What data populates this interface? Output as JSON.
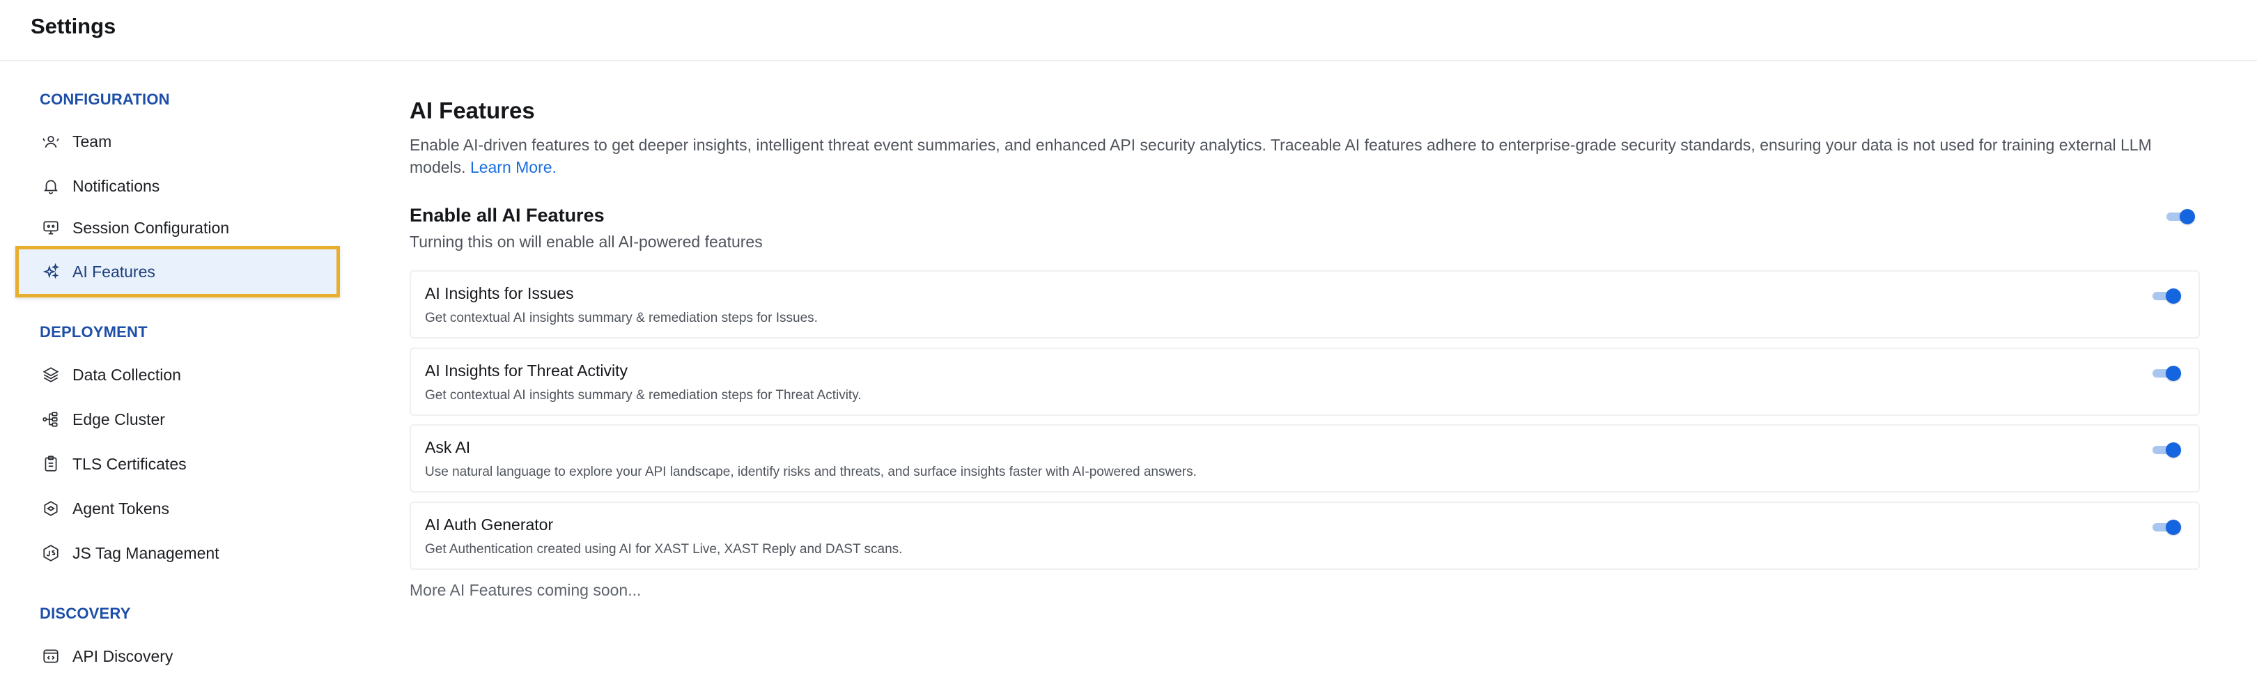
{
  "header": {
    "title": "Settings"
  },
  "sidebar": {
    "sections": [
      {
        "label": "CONFIGURATION",
        "items": [
          {
            "label": "Team",
            "icon": "team-icon"
          },
          {
            "label": "Notifications",
            "icon": "bell-icon"
          },
          {
            "label": "Session Configuration",
            "icon": "session-icon"
          },
          {
            "label": "AI Features",
            "icon": "sparkle-icon",
            "active": true
          }
        ]
      },
      {
        "label": "DEPLOYMENT",
        "items": [
          {
            "label": "Data Collection",
            "icon": "layers-icon"
          },
          {
            "label": "Edge Cluster",
            "icon": "cluster-icon"
          },
          {
            "label": "TLS Certificates",
            "icon": "clipboard-icon"
          },
          {
            "label": "Agent Tokens",
            "icon": "token-icon"
          },
          {
            "label": "JS Tag Management",
            "icon": "js-tag-icon"
          }
        ]
      },
      {
        "label": "DISCOVERY",
        "items": [
          {
            "label": "API Discovery",
            "icon": "code-window-icon"
          }
        ]
      }
    ]
  },
  "main": {
    "title": "AI Features",
    "description": "Enable AI-driven features to get deeper insights, intelligent threat event summaries, and enhanced API security analytics. Traceable AI features adhere to enterprise-grade security standards, ensuring your data is not used for training external LLM models.",
    "learn_more": "Learn More.",
    "enable_all": {
      "title": "Enable all AI Features",
      "subtitle": "Turning this on will enable all AI-powered features",
      "enabled": true
    },
    "features": [
      {
        "title": "AI Insights for Issues",
        "description": "Get contextual AI insights summary & remediation steps for Issues.",
        "enabled": true
      },
      {
        "title": "AI Insights for Threat Activity",
        "description": "Get contextual AI insights summary & remediation steps for Threat Activity.",
        "enabled": true
      },
      {
        "title": "Ask AI",
        "description": "Use natural language to explore your API landscape, identify risks and threats, and surface insights faster with AI-powered answers.",
        "enabled": true
      },
      {
        "title": "AI Auth Generator",
        "description": "Get Authentication created using AI for XAST Live, XAST Reply and DAST scans.",
        "enabled": true
      }
    ],
    "footer_note": "More AI Features coming soon..."
  },
  "colors": {
    "accent": "#1565e0",
    "section_head": "#1d4fa8",
    "active_bg": "#e9f2fc",
    "highlight_border": "#e8ae2e"
  }
}
